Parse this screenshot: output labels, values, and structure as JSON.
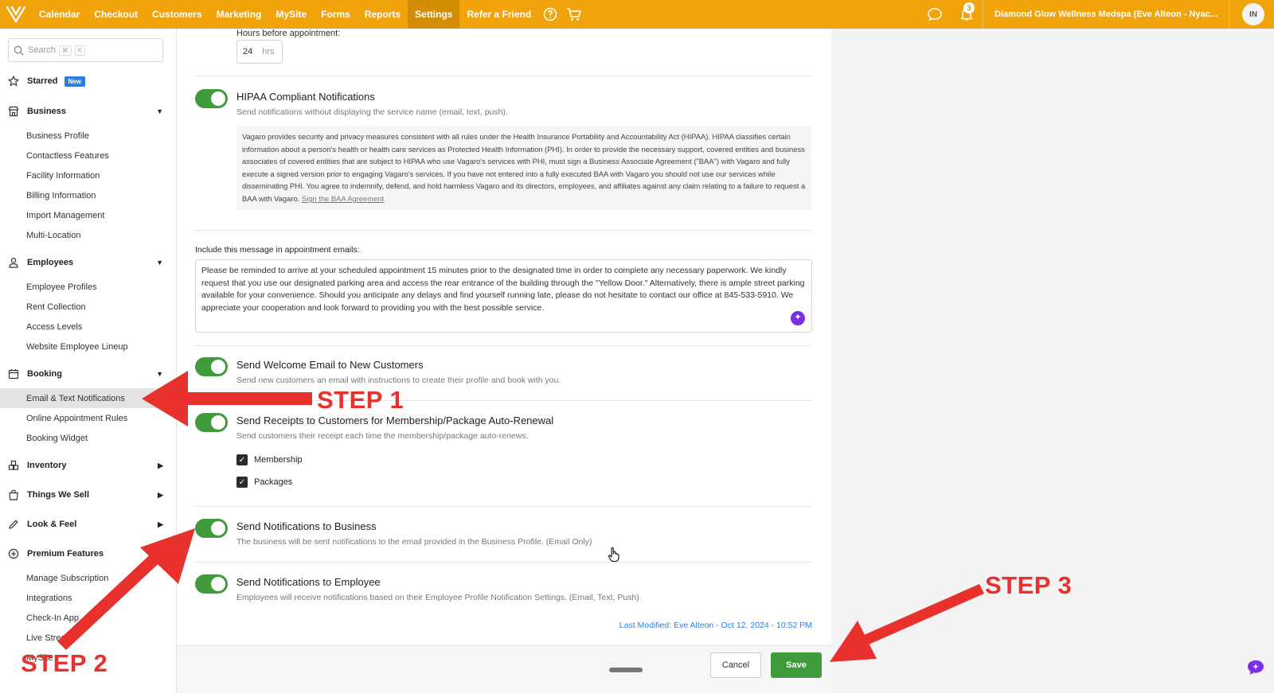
{
  "topnav": {
    "items": [
      "Calendar",
      "Checkout",
      "Customers",
      "Marketing",
      "MySite",
      "Forms",
      "Reports",
      "Settings",
      "Refer a Friend"
    ],
    "active": "Settings",
    "notification_count": "3",
    "business_name": "Diamond Glow Wellness Medspa (Eve Alteon - Nyac...",
    "avatar_initials": "IN",
    "colors": {
      "bar": "#f0a30a",
      "active": "#d38e05"
    }
  },
  "sidebar": {
    "search_placeholder": "Search",
    "search_kbd": [
      "⌘",
      "K"
    ],
    "starred": {
      "label": "Starred",
      "badge": "New"
    },
    "business": {
      "label": "Business",
      "items": [
        "Business Profile",
        "Contactless Features",
        "Facility Information",
        "Billing Information",
        "Import Management",
        "Multi-Location"
      ]
    },
    "employees": {
      "label": "Employees",
      "items": [
        "Employee Profiles",
        "Rent Collection",
        "Access Levels",
        "Website Employee Lineup"
      ]
    },
    "booking": {
      "label": "Booking",
      "items": [
        "Email & Text Notifications",
        "Online Appointment Rules",
        "Booking Widget"
      ]
    },
    "inventory": {
      "label": "Inventory"
    },
    "things_we_sell": {
      "label": "Things We Sell"
    },
    "look_feel": {
      "label": "Look & Feel"
    },
    "premium": {
      "label": "Premium Features",
      "items": [
        "Manage Subscription",
        "Integrations",
        "Check-In App",
        "Live Stream",
        "MySite"
      ]
    }
  },
  "main": {
    "hours_label": "Hours before appointment:",
    "hours_value": "24",
    "hours_unit": "hrs",
    "hipaa": {
      "title": "HIPAA Compliant Notifications",
      "desc": "Send notifications without displaying the service name (email, text, push).",
      "body": "Vagaro provides security and privacy measures consistent with all rules under the Health Insurance Portability and Accountability Act (HIPAA). HIPAA classifies certain information about a person's health or health care services as Protected Health Information (PHI). In order to provide the necessary support, covered entities and business associates of covered entities that are subject to HIPAA who use Vagaro's services with PHI, must sign a Business Associate Agreement (\"BAA\") with Vagaro and fully execute a signed version prior to engaging Vagaro's services. If you have not entered into a fully executed BAA with Vagaro you should not use our services while disseminating PHI. You agree to indemnify, defend, and hold harmless Vagaro and its directors, employees, and affiliates against any claim relating to a failure to request a BAA with Vagaro.",
      "link": "Sign the BAA Agreement"
    },
    "message_label": "Include this message in appointment emails:",
    "message_text": "Please be reminded to arrive at your scheduled appointment 15 minutes prior to the designated time in order to complete any necessary paperwork. We kindly request that you use our designated parking area and access the rear entrance of the building through the \"Yellow Door.\" Alternatively, there is ample street parking available for your convenience. Should you anticipate any delays and find yourself running late, please do not hesitate to contact our office at 845-533-5910. We appreciate your cooperation and look forward to providing you with the best possible service.",
    "welcome": {
      "title": "Send Welcome Email to New Customers",
      "desc": "Send new customers an email with instructions to create their profile and book with you."
    },
    "receipts": {
      "title": "Send Receipts to Customers for Membership/Package Auto-Renewal",
      "desc": "Send customers their receipt each time the membership/package auto-renews.",
      "checks": [
        "Membership",
        "Packages"
      ]
    },
    "biz_notif": {
      "title": "Send Notifications to Business",
      "desc": "The business will be sent notifications to the email provided in the Business Profile. (Email Only)"
    },
    "emp_notif": {
      "title": "Send Notifications to Employee",
      "desc": "Employees will receive notifications based on their Employee Profile Notification Settings. (Email, Text, Push)"
    },
    "last_modified": "Last Modified: Eve Alteon - Oct 12, 2024 - 10:52 PM",
    "cancel_label": "Cancel",
    "save_label": "Save"
  },
  "annotations": {
    "step1": "STEP 1",
    "step2": "STEP 2",
    "step3": "STEP 3",
    "color": "#e8302d"
  }
}
